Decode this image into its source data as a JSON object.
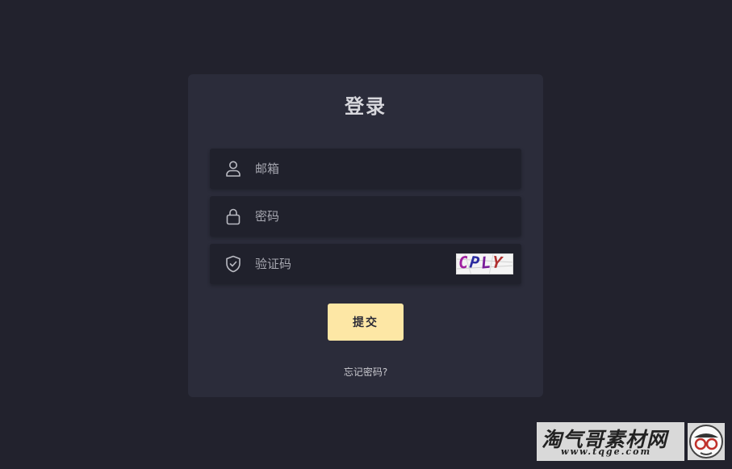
{
  "form": {
    "title": "登录",
    "email_placeholder": "邮箱",
    "password_placeholder": "密码",
    "captcha_placeholder": "验证码",
    "captcha_code": "CPLY",
    "submit_label": "提交",
    "forgot_label": "忘记密码?"
  },
  "icons": {
    "email": "user-icon",
    "password": "lock-icon",
    "captcha": "shield-check-icon"
  },
  "colors": {
    "background": "#22222d",
    "card": "#2b2c3a",
    "field": "#20212c",
    "accent": "#fde7a5",
    "captcha_colors": [
      "#a020a0",
      "#2c2ca0",
      "#7a1e9a",
      "#b03030"
    ]
  },
  "watermark": {
    "main": "淘气哥素材网",
    "sub": "www.tqge.com"
  }
}
